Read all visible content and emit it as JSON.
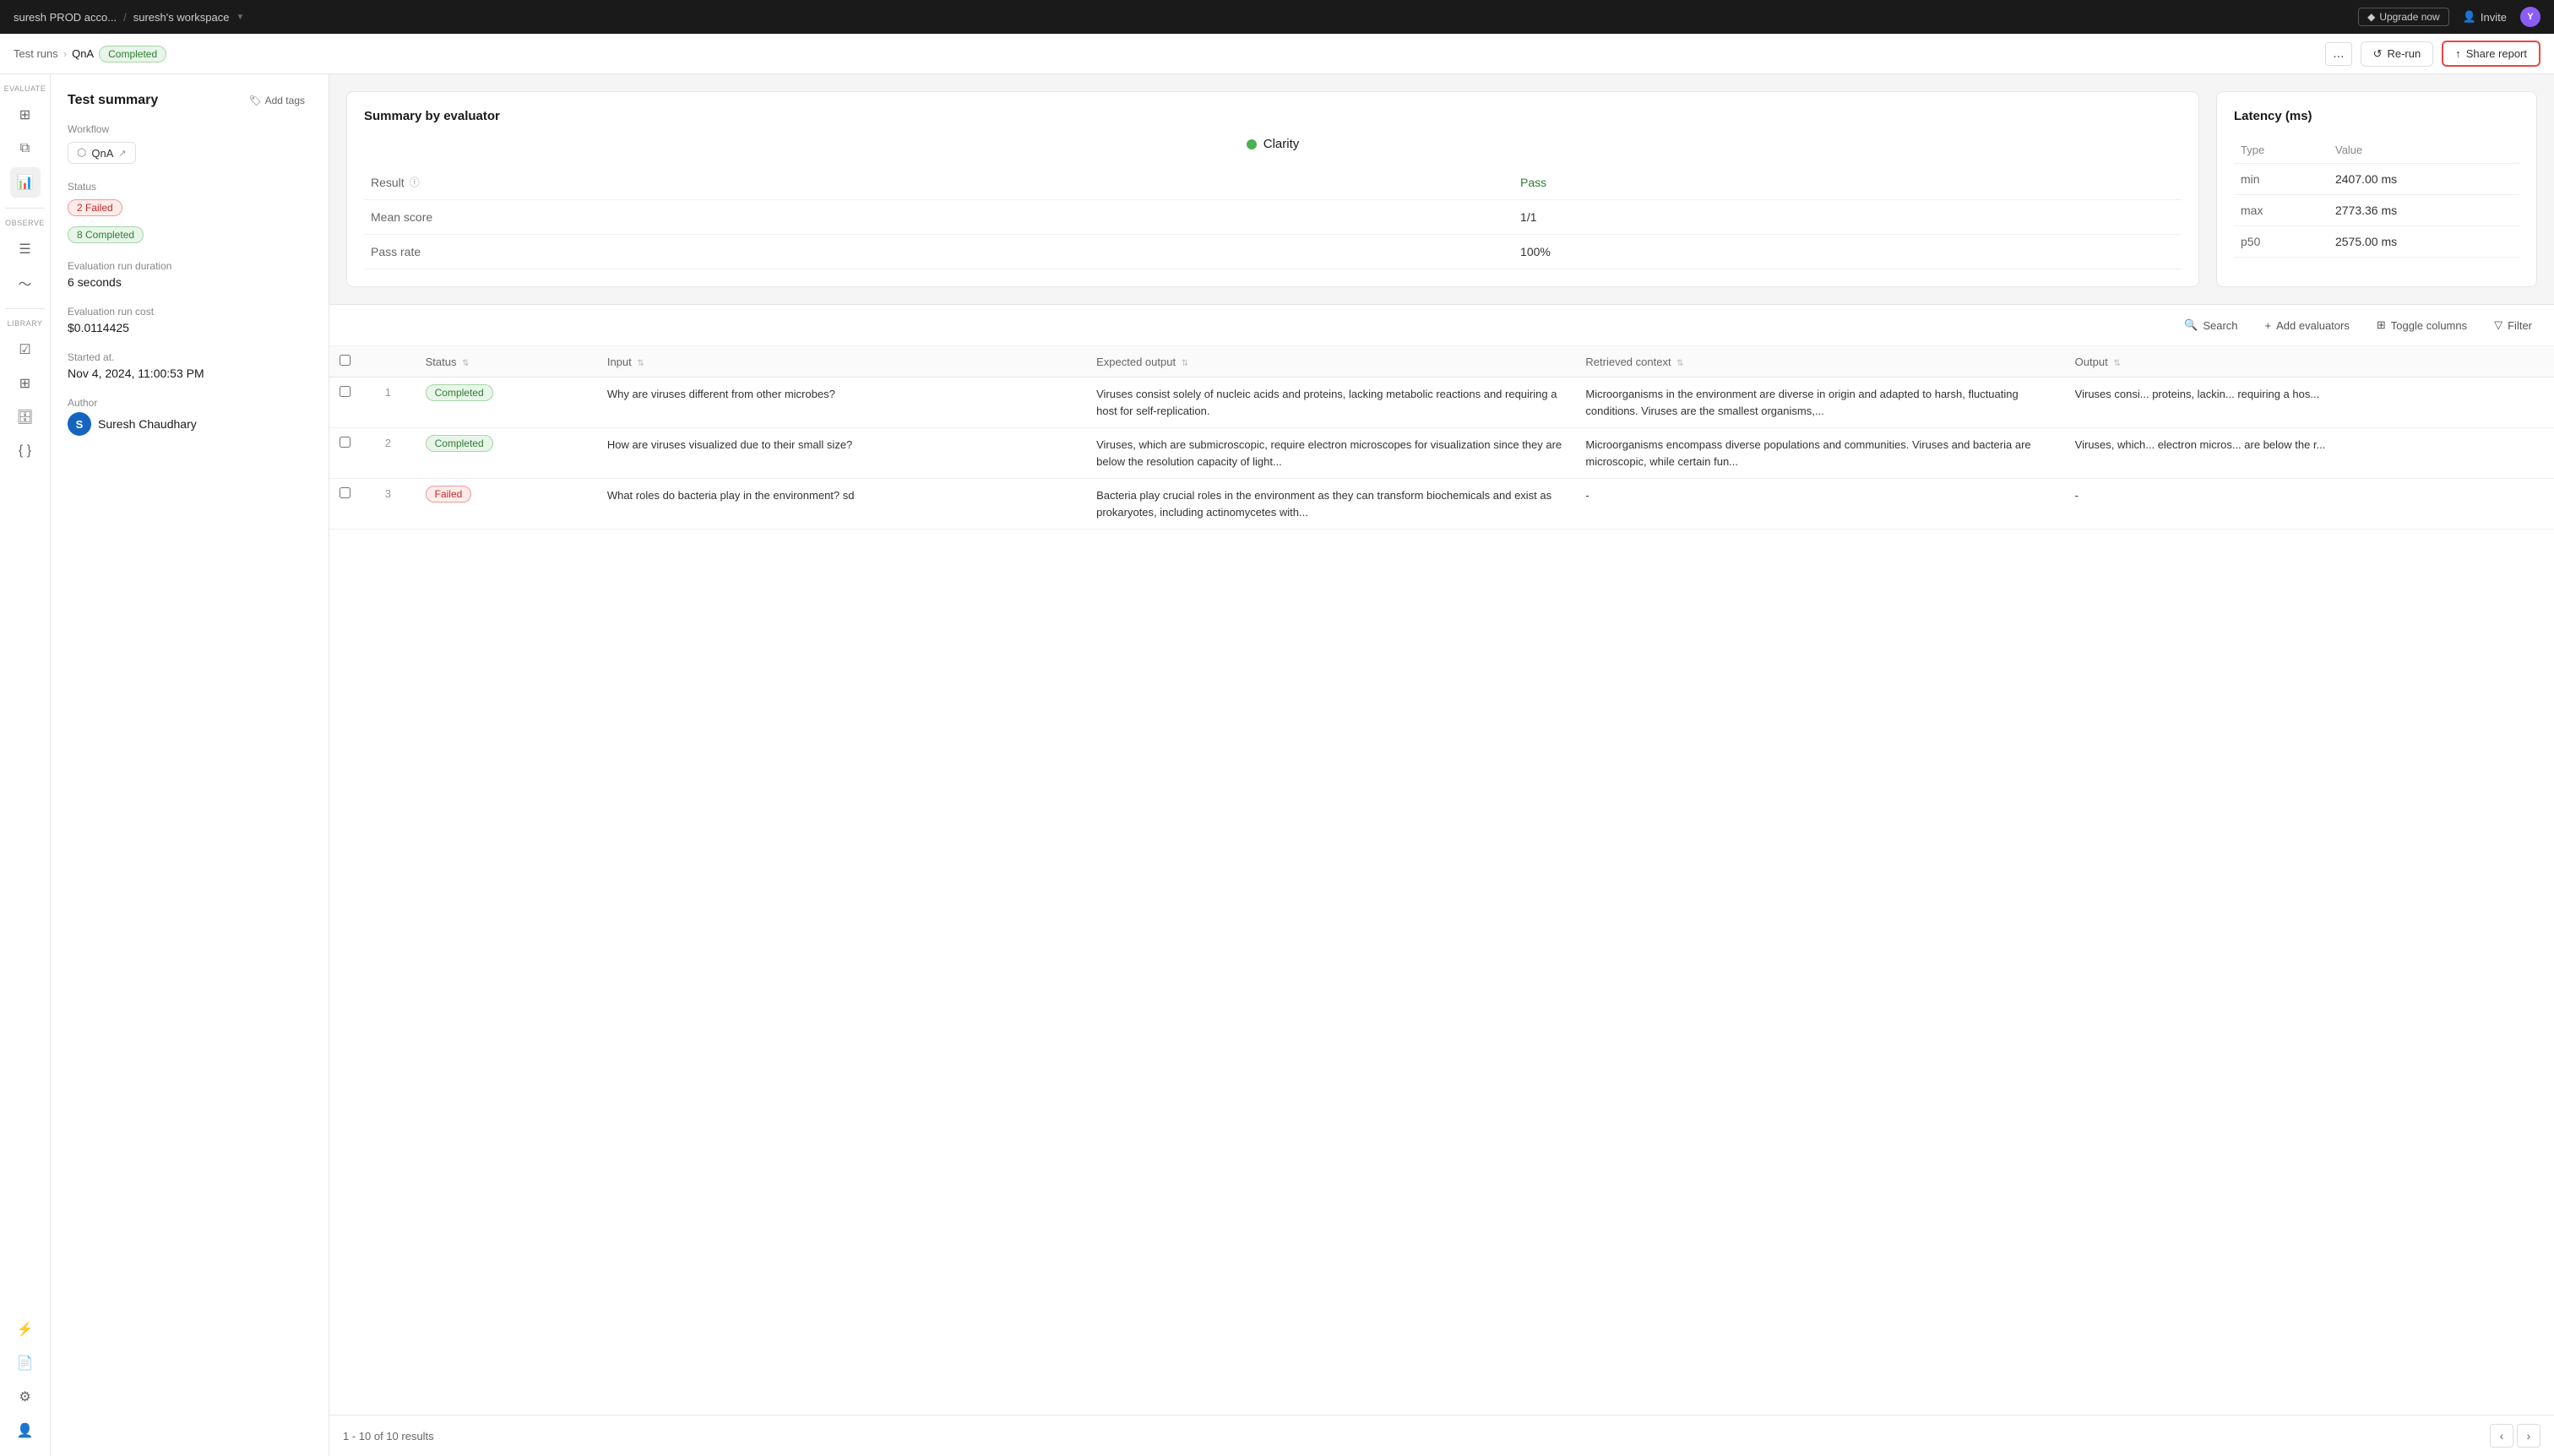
{
  "topbar": {
    "account": "suresh PROD acco...",
    "separator": "/",
    "workspace": "suresh's workspace",
    "upgrade_label": "Upgrade now",
    "invite_label": "Invite",
    "user_initial": "Y"
  },
  "breadcrumb": {
    "test_runs": "Test runs",
    "current": "QnA",
    "status": "Completed",
    "more_label": "...",
    "rerun_label": "Re-run",
    "share_label": "Share report"
  },
  "sidebar": {
    "groups": [
      {
        "label": "EVALUATE",
        "icons": [
          "grid",
          "layers",
          "bar-chart"
        ]
      },
      {
        "label": "OBSERVE",
        "icons": [
          "list",
          "activity"
        ]
      },
      {
        "label": "LIBRARY",
        "icons": [
          "check-square",
          "table",
          "database",
          "code"
        ]
      }
    ],
    "bottom_icons": [
      "zap",
      "file-text",
      "settings",
      "user-circle"
    ]
  },
  "summary_panel": {
    "title": "Test summary",
    "add_tags_label": "Add tags",
    "workflow_label": "Workflow",
    "workflow_name": "QnA",
    "status_label": "Status",
    "failed_badge": "2 Failed",
    "completed_badge": "8 Completed",
    "duration_label": "Evaluation run duration",
    "duration_value": "6 seconds",
    "cost_label": "Evaluation run cost",
    "cost_value": "$0.0114425",
    "started_label": "Started at.",
    "started_value": "Nov 4, 2024, 11:00:53 PM",
    "author_label": "Author",
    "author_name": "Suresh Chaudhary",
    "author_initial": "S"
  },
  "evaluator_card": {
    "title": "Summary by evaluator",
    "evaluator_name": "Clarity",
    "result_label": "Result",
    "result_info_icon": "?",
    "result_value": "Pass",
    "mean_score_label": "Mean score",
    "mean_score_value": "1/1",
    "pass_rate_label": "Pass rate",
    "pass_rate_value": "100%"
  },
  "latency_card": {
    "title": "Latency (ms)",
    "columns": [
      "Type",
      "Value"
    ],
    "rows": [
      {
        "type": "min",
        "value": "2407.00 ms"
      },
      {
        "type": "max",
        "value": "2773.36 ms"
      },
      {
        "type": "p50",
        "value": "2575.00 ms"
      }
    ]
  },
  "table": {
    "toolbar": {
      "search_label": "Search",
      "add_evaluators_label": "Add evaluators",
      "toggle_columns_label": "Toggle columns",
      "filter_label": "Filter"
    },
    "columns": [
      "Status",
      "Input",
      "Expected output",
      "Retrieved context",
      "Output"
    ],
    "rows": [
      {
        "num": "1",
        "status": "Completed",
        "input": "Why are viruses different from other microbes?",
        "expected_output": "Viruses consist solely of nucleic acids and proteins, lacking metabolic reactions and requiring a host for self-replication.",
        "retrieved_context": "Microorganisms in the environment are diverse in origin and adapted to harsh, fluctuating conditions. Viruses are the smallest organisms,...",
        "output": "Viruses consi... proteins, lackin... requiring a hos..."
      },
      {
        "num": "2",
        "status": "Completed",
        "input": "How are viruses visualized due to their small size?",
        "expected_output": "Viruses, which are submicroscopic, require electron microscopes for visualization since they are below the resolution capacity of light...",
        "retrieved_context": "Microorganisms encompass diverse populations and communities. Viruses and bacteria are microscopic, while certain fun...",
        "output": "Viruses, which... electron micros... are below the r..."
      },
      {
        "num": "3",
        "status": "Failed",
        "input": "What roles do bacteria play in the environment? sd",
        "expected_output": "Bacteria play crucial roles in the environment as they can transform biochemicals and exist as prokaryotes, including actinomycetes with...",
        "retrieved_context": "-",
        "output": "-"
      }
    ],
    "pagination": {
      "label": "1 - 10 of 10 results"
    }
  }
}
